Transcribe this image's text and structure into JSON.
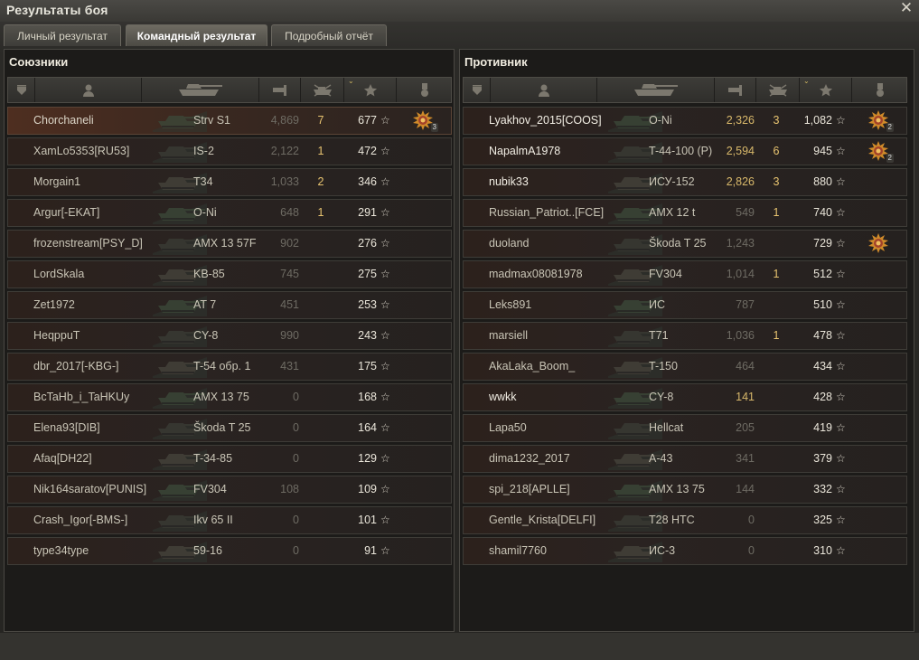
{
  "window": {
    "title": "Результаты боя",
    "close_icon": "close-icon"
  },
  "tabs": [
    {
      "label": "Личный результат",
      "active": false
    },
    {
      "label": "Командный результат",
      "active": true
    },
    {
      "label": "Подробный отчёт",
      "active": false
    }
  ],
  "allies": {
    "title": "Союзники",
    "rows": [
      {
        "name": "Chorchaneli",
        "tank": "Strv S1",
        "damage": "4,869",
        "kills": "7",
        "xp": "677",
        "medal": true,
        "medal_count": "3",
        "me": true
      },
      {
        "name": "XamLo5353[RU53]",
        "tank": "IS-2",
        "damage": "2,122",
        "kills": "1",
        "xp": "472"
      },
      {
        "name": "Morgain1",
        "tank": "T34",
        "damage": "1,033",
        "kills": "2",
        "xp": "346"
      },
      {
        "name": "Argur[-EKAT]",
        "tank": "O-Ni",
        "damage": "648",
        "kills": "1",
        "xp": "291"
      },
      {
        "name": "frozenstream[PSY_D]",
        "tank": "AMX 13 57F",
        "damage": "902",
        "kills": "",
        "xp": "276"
      },
      {
        "name": "LordSkala",
        "tank": "KB-85",
        "damage": "745",
        "kills": "",
        "xp": "275"
      },
      {
        "name": "Zet1972",
        "tank": "AT 7",
        "damage": "451",
        "kills": "",
        "xp": "253"
      },
      {
        "name": "HeqppuT",
        "tank": "CY-8",
        "damage": "990",
        "kills": "",
        "xp": "243"
      },
      {
        "name": "dbr_2017[-KBG-]",
        "tank": "T-54 обр. 1",
        "damage": "431",
        "kills": "",
        "xp": "175"
      },
      {
        "name": "BcTaHb_i_TaHKUy",
        "tank": "AMX 13 75",
        "damage": "0",
        "kills": "",
        "xp": "168"
      },
      {
        "name": "Elena93[DIB]",
        "tank": "Škoda T 25",
        "damage": "0",
        "kills": "",
        "xp": "164"
      },
      {
        "name": "Afaq[DH22]",
        "tank": "T-34-85",
        "damage": "0",
        "kills": "",
        "xp": "129"
      },
      {
        "name": "Nik164saratov[PUNIS]",
        "tank": "FV304",
        "damage": "108",
        "kills": "",
        "xp": "109"
      },
      {
        "name": "Crash_Igor[-BMS-]",
        "tank": "Ikv 65 II",
        "damage": "0",
        "kills": "",
        "xp": "101"
      },
      {
        "name": "type34type",
        "tank": "59-16",
        "damage": "0",
        "kills": "",
        "xp": "91"
      }
    ]
  },
  "enemies": {
    "title": "Противник",
    "rows": [
      {
        "name": "Lyakhov_2015[COOS]",
        "tank": "O-Ni",
        "damage": "2,326",
        "kills": "3",
        "xp": "1,082",
        "medal": true,
        "medal_count": "2",
        "bright": true,
        "hi": true
      },
      {
        "name": "NapalmA1978",
        "tank": "T-44-100 (P)",
        "damage": "2,594",
        "kills": "6",
        "xp": "945",
        "medal": true,
        "medal_count": "2",
        "bright": true,
        "hi": true
      },
      {
        "name": "nubik33",
        "tank": "ИСУ-152",
        "damage": "2,826",
        "kills": "3",
        "xp": "880",
        "bright": true,
        "hi": true
      },
      {
        "name": "Russian_Patriot..[FCE]",
        "tank": "AMX 12 t",
        "damage": "549",
        "kills": "1",
        "xp": "740"
      },
      {
        "name": "duoland",
        "tank": "Škoda T 25",
        "damage": "1,243",
        "kills": "",
        "xp": "729",
        "medal": true,
        "medal_count": ""
      },
      {
        "name": "madmax08081978",
        "tank": "FV304",
        "damage": "1,014",
        "kills": "1",
        "xp": "512"
      },
      {
        "name": "Leks891",
        "tank": "ИС",
        "damage": "787",
        "kills": "",
        "xp": "510"
      },
      {
        "name": "marsiell",
        "tank": "T71",
        "damage": "1,036",
        "kills": "1",
        "xp": "478"
      },
      {
        "name": "AkaLaka_Boom_",
        "tank": "T-150",
        "damage": "464",
        "kills": "",
        "xp": "434"
      },
      {
        "name": "wwkk",
        "tank": "CY-8",
        "damage": "141",
        "kills": "",
        "xp": "428",
        "bright": true,
        "hi": true
      },
      {
        "name": "Lapa50",
        "tank": "Hellcat",
        "damage": "205",
        "kills": "",
        "xp": "419"
      },
      {
        "name": "dima1232_2017",
        "tank": "A-43",
        "damage": "341",
        "kills": "",
        "xp": "379"
      },
      {
        "name": "spi_218[APLLE]",
        "tank": "AMX 13 75",
        "damage": "144",
        "kills": "",
        "xp": "332"
      },
      {
        "name": "Gentle_Krista[DELFI]",
        "tank": "T28 HTC",
        "damage": "0",
        "kills": "",
        "xp": "325"
      },
      {
        "name": "shamil7760",
        "tank": "ИС-3",
        "damage": "0",
        "kills": "",
        "xp": "310"
      }
    ]
  },
  "columns": [
    "squad-icon",
    "player-icon",
    "tank-icon",
    "damage-icon",
    "kills-icon",
    "xp-star-icon",
    "medal-icon"
  ],
  "colors": {
    "accent": "#e8c470",
    "panel": "#1c1b19",
    "row_me": "#4e2e20"
  }
}
